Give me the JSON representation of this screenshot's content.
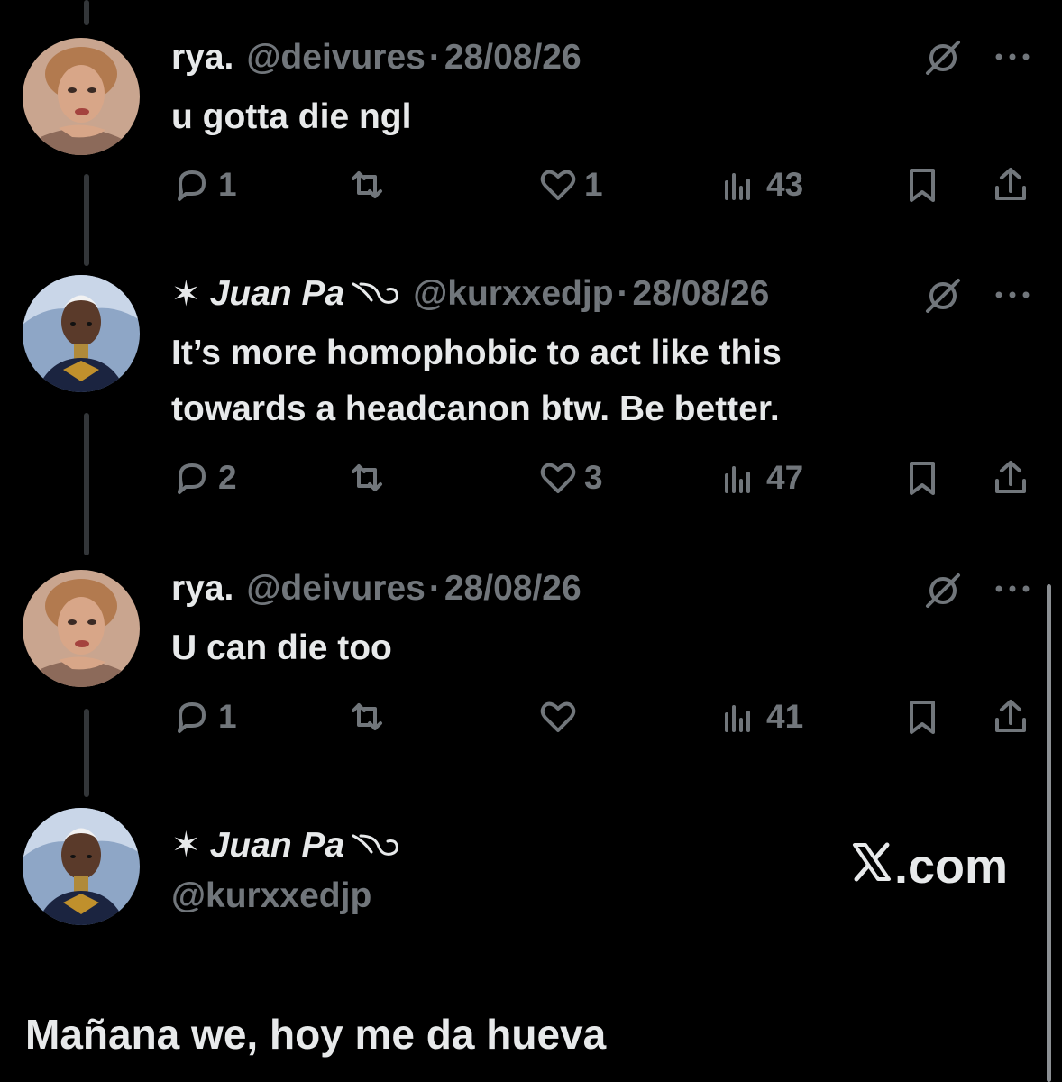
{
  "thread": [
    {
      "author": "rya.",
      "handle": "@deivures",
      "separator": "·",
      "date": "28/08/26",
      "text_lines": [
        "u gotta die ngl"
      ],
      "replies": "1",
      "reposts": "",
      "likes": "1",
      "views": "43",
      "avatar": "avatar-woman-portrait"
    },
    {
      "author_prefix": "✶",
      "author": "Juan Pa",
      "handle": "@kurxxedjp",
      "separator": "·",
      "date": "28/08/26",
      "text_lines": [
        "It’s more homophobic to act like this",
        "towards a headcanon btw. Be better."
      ],
      "replies": "2",
      "reposts": "",
      "likes": "3",
      "views": "47",
      "avatar": "avatar-storm-illustration"
    },
    {
      "author": "rya.",
      "handle": "@deivures",
      "separator": "·",
      "date": "28/08/26",
      "text_lines": [
        "U can die too"
      ],
      "replies": "1",
      "reposts": "",
      "likes": "",
      "views": "41",
      "avatar": "avatar-woman-portrait"
    }
  ],
  "profile": {
    "name_prefix": "✶",
    "name": "Juan Pa",
    "handle": "@kurxxedjp"
  },
  "brand": {
    "text": ".com"
  },
  "caption": "Mañana we, hoy me da hueva",
  "colors": {
    "background": "#000000",
    "text_primary": "#e7e9ea",
    "text_secondary": "#71767b",
    "thread_line": "#333639"
  },
  "icons": [
    "reply-icon",
    "repost-icon",
    "like-icon",
    "views-icon",
    "bookmark-icon",
    "share-icon",
    "grok-icon",
    "more-icon",
    "x-logo-icon"
  ]
}
